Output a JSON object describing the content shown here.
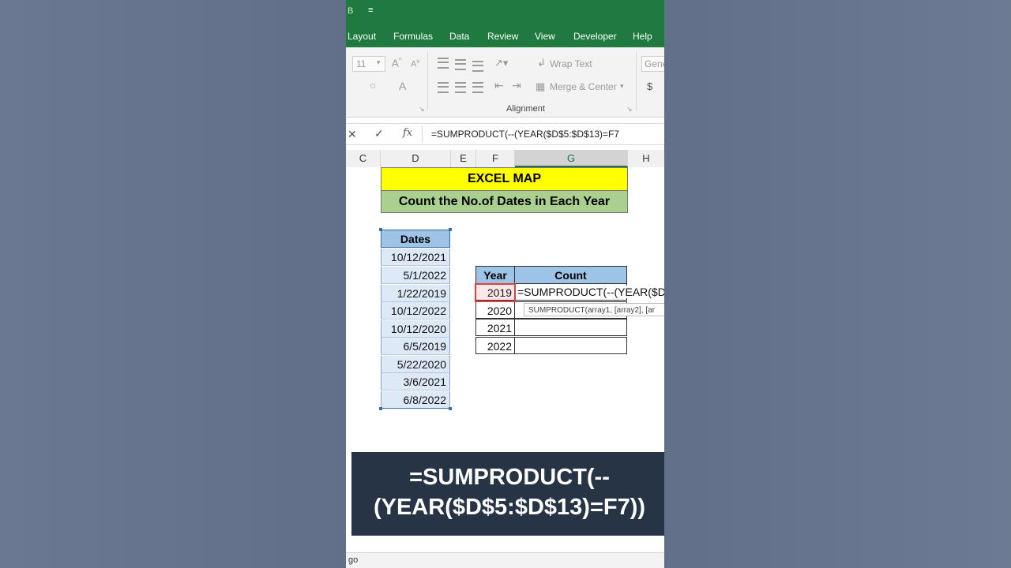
{
  "ribbon_tabs": [
    "Layout",
    "Formulas",
    "Data",
    "Review",
    "View",
    "Developer",
    "Help"
  ],
  "ribbon": {
    "font_size": "11",
    "wrap_text": "Wrap Text",
    "merge_center": "Merge & Center",
    "number_format": "Gene",
    "currency": "$",
    "group_label": "Alignment"
  },
  "formula_bar": {
    "cancel": "✕",
    "enter": "✓",
    "fx": "fx",
    "formula": "=SUMPRODUCT(--(YEAR($D$5:$D$13)=F7"
  },
  "columns": [
    "C",
    "D",
    "E",
    "F",
    "G",
    "H"
  ],
  "sheet": {
    "title": "EXCEL MAP",
    "subtitle": "Count the No.of Dates in Each Year",
    "dates_header": "Dates",
    "dates": [
      "10/12/2021",
      "5/1/2022",
      "1/22/2019",
      "10/12/2022",
      "10/12/2020",
      "6/5/2019",
      "5/22/2020",
      "3/6/2021",
      "6/8/2022"
    ],
    "year_header": "Year",
    "count_header": "Count",
    "years": [
      "2019",
      "2020",
      "2021",
      "2022"
    ],
    "editing_formula": "=SUMPRODUCT(--(YEAR($D",
    "tooltip": "SUMPRODUCT(array1, [array2], [ar"
  },
  "caption": {
    "line1": "=SUMPRODUCT(--",
    "line2": "(YEAR($D$5:$D$13)=F7))"
  },
  "status": "go"
}
